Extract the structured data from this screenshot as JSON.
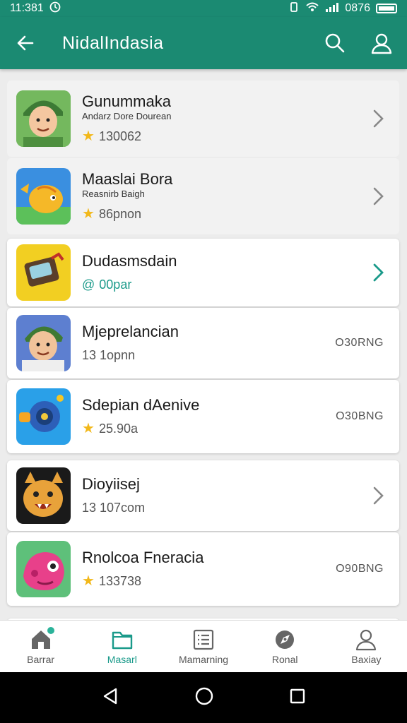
{
  "status_bar": {
    "time": "11:381",
    "signal_text": "0876"
  },
  "app_bar": {
    "title": "NidalIndasia"
  },
  "list": [
    {
      "name": "Gunummaka",
      "subtitle": "Andarz Dore Dourean",
      "meta": "130062",
      "meta_icon": "star",
      "trailing": "chevron"
    },
    {
      "name": "Maaslai Bora",
      "subtitle": "Reasnirb Baigh",
      "meta": "86pnon",
      "meta_icon": "star",
      "trailing": "chevron"
    },
    {
      "name": "Dudasmsdain",
      "subtitle": "",
      "meta": "00par",
      "meta_icon": "at",
      "trailing": "chevron-teal"
    },
    {
      "name": "Mjeprelancian",
      "subtitle": "",
      "meta": "13 1opnn",
      "meta_icon": "none",
      "trailing": "O30RNG"
    },
    {
      "name": "Sdepian dAenive",
      "subtitle": "",
      "meta": "25.90a",
      "meta_icon": "star",
      "trailing": "O30BNG"
    },
    {
      "name": "Dioyiisej",
      "subtitle": "",
      "meta": "13 107com",
      "meta_icon": "none",
      "trailing": "chevron"
    },
    {
      "name": "Rnolcoa Fneracia",
      "subtitle": "",
      "meta": "133738",
      "meta_icon": "star",
      "trailing": "O90BNG"
    }
  ],
  "bottom_nav": [
    {
      "label": "Barrar",
      "icon": "home-icon",
      "active": false
    },
    {
      "label": "Masarl",
      "icon": "folder-icon",
      "active": true
    },
    {
      "label": "Mamarning",
      "icon": "list-icon",
      "active": false
    },
    {
      "label": "Ronal",
      "icon": "compass-icon",
      "active": false
    },
    {
      "label": "Baxiay",
      "icon": "profile-icon",
      "active": false
    }
  ],
  "colors": {
    "primary": "#1b8a72",
    "accent": "#1a9a8a",
    "star": "#f2b81a"
  }
}
